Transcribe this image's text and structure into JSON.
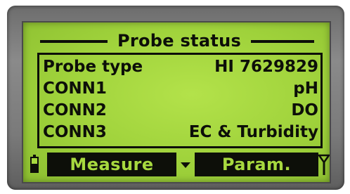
{
  "screen": {
    "title": "Probe status",
    "rows": [
      {
        "label": "Probe type",
        "value": "HI 7629829"
      },
      {
        "label": "CONN1",
        "value": "pH"
      },
      {
        "label": "CONN2",
        "value": "DO"
      },
      {
        "label": "CONN3",
        "value": "EC & Turbidity"
      }
    ]
  },
  "softkeys": {
    "left_label": "Measure",
    "right_label": "Param."
  },
  "icons": {
    "battery": "battery-icon",
    "menu_arrow": "down-arrow-icon",
    "signal": "antenna-icon"
  },
  "colors": {
    "lcd_background": "#a7d93f",
    "lcd_text": "#0d0f09",
    "bezel": "#7a7a7a"
  }
}
